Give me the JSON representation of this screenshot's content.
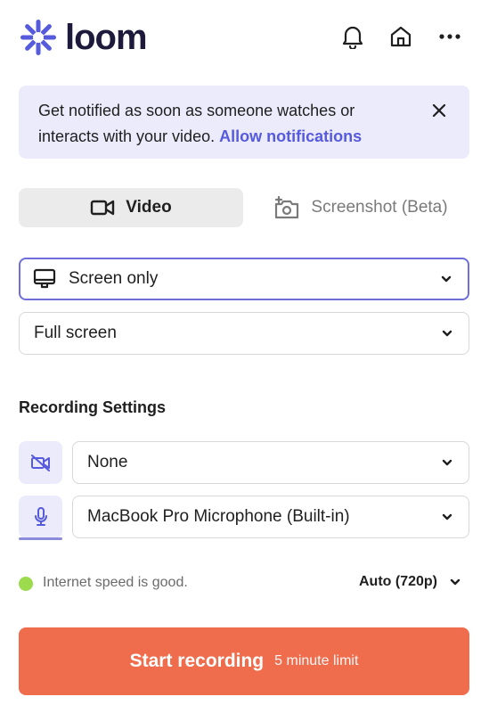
{
  "brand": {
    "name": "loom",
    "accent": "#565add"
  },
  "header": {
    "icons": [
      "bell-icon",
      "home-icon",
      "more-icon"
    ]
  },
  "notice": {
    "text": "Get notified as soon as someone watches or interacts with your video.",
    "link_label": "Allow notifications",
    "close_icon": "close-icon"
  },
  "tabs": [
    {
      "label": "Video",
      "icon": "video-camera-icon",
      "active": true
    },
    {
      "label": "Screenshot (Beta)",
      "icon": "camera-plus-icon",
      "active": false
    }
  ],
  "capture_mode": {
    "value": "Screen only",
    "icon": "monitor-icon"
  },
  "capture_area": {
    "value": "Full screen"
  },
  "recording_settings": {
    "title": "Recording Settings",
    "camera": {
      "value": "None",
      "icon": "camera-off-icon"
    },
    "microphone": {
      "value": "MacBook Pro Microphone (Built-in)",
      "icon": "microphone-icon"
    }
  },
  "status": {
    "text": "Internet speed is good.",
    "indicator_color": "#9bdb4d",
    "quality": "Auto (720p)"
  },
  "start": {
    "label": "Start recording",
    "limit": "5 minute limit",
    "color": "#ef6c4d"
  }
}
